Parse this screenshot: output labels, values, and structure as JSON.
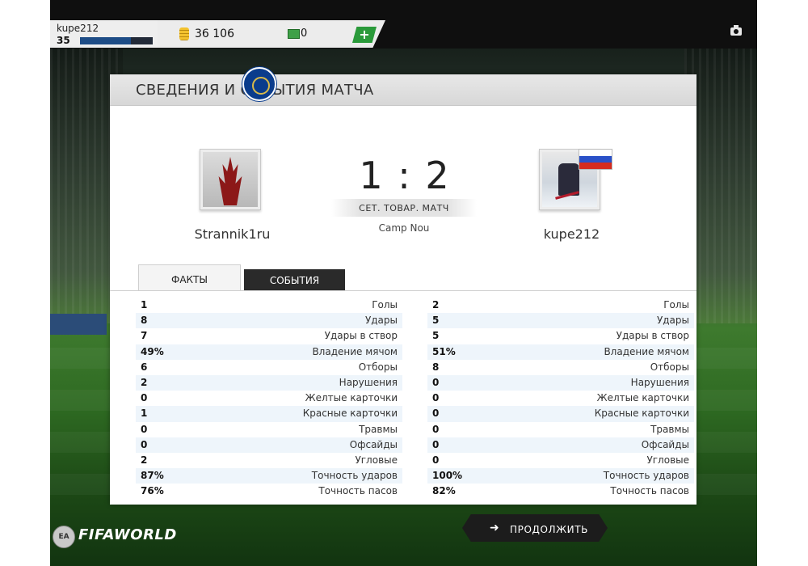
{
  "header": {
    "username": "kupe212",
    "level": "35",
    "xp_progress": 0.7,
    "coins": "36 106",
    "cash": "0"
  },
  "panel": {
    "title": "СВЕДЕНИЯ И СОБЫТИЯ МАТЧА"
  },
  "match": {
    "team1": "Strannik1ru",
    "team2": "kupe212",
    "score": "1 : 2",
    "match_type": "СЕТ. ТОВАР. МАТЧ",
    "venue": "Camp Nou"
  },
  "tabs": {
    "facts": "ФАКТЫ",
    "events": "СОБЫТИЯ"
  },
  "stats": {
    "left": [
      {
        "value": "1",
        "label": "Голы"
      },
      {
        "value": "8",
        "label": "Удары"
      },
      {
        "value": "7",
        "label": "Удары в створ"
      },
      {
        "value": "49%",
        "label": "Владение мячом"
      },
      {
        "value": "6",
        "label": "Отборы"
      },
      {
        "value": "2",
        "label": "Нарушения"
      },
      {
        "value": "0",
        "label": "Желтые карточки"
      },
      {
        "value": "1",
        "label": "Красные карточки"
      },
      {
        "value": "0",
        "label": "Травмы"
      },
      {
        "value": "0",
        "label": "Офсайды"
      },
      {
        "value": "2",
        "label": "Угловые"
      },
      {
        "value": "87%",
        "label": "Точность ударов"
      },
      {
        "value": "76%",
        "label": "Точность пасов"
      }
    ],
    "right": [
      {
        "value": "2",
        "label": "Голы"
      },
      {
        "value": "5",
        "label": "Удары"
      },
      {
        "value": "5",
        "label": "Удары в створ"
      },
      {
        "value": "51%",
        "label": "Владение мячом"
      },
      {
        "value": "8",
        "label": "Отборы"
      },
      {
        "value": "0",
        "label": "Нарушения"
      },
      {
        "value": "0",
        "label": "Желтые карточки"
      },
      {
        "value": "0",
        "label": "Красные карточки"
      },
      {
        "value": "0",
        "label": "Травмы"
      },
      {
        "value": "0",
        "label": "Офсайды"
      },
      {
        "value": "0",
        "label": "Угловые"
      },
      {
        "value": "100%",
        "label": "Точность ударов"
      },
      {
        "value": "82%",
        "label": "Точность пасов"
      }
    ]
  },
  "footer": {
    "brand": "FIFAWORLD",
    "ea_logo": "EA",
    "continue_label": "ПРОДОЛЖИТЬ",
    "continue_icon": "arrow-right-icon"
  }
}
